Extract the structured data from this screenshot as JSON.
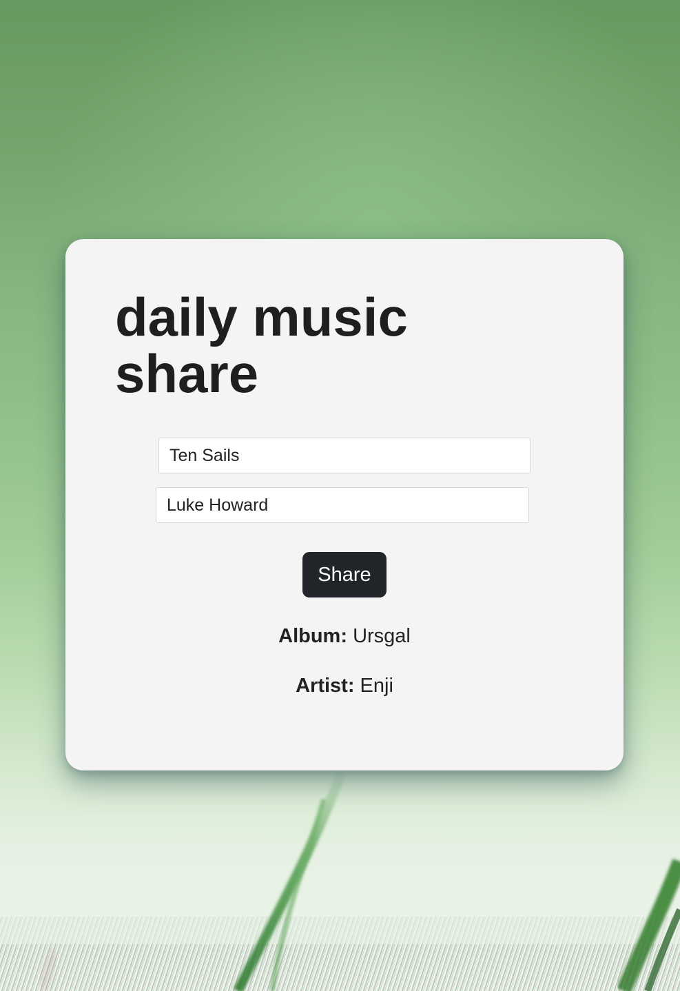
{
  "app": {
    "title": "daily music share"
  },
  "form": {
    "album_value": "Ten Sails",
    "artist_value": "Luke Howard",
    "share_label": "Share"
  },
  "result": {
    "album_label": "Album:",
    "album_value": "Ursgal",
    "artist_label": "Artist:",
    "artist_value": "Enji"
  },
  "colors": {
    "card_background": "#f4f4f4",
    "button_background": "#212428",
    "text": "#1f1f1f",
    "background_green": "#74a56c"
  },
  "icons": {
    "background": "blurred-green-plant-image"
  }
}
